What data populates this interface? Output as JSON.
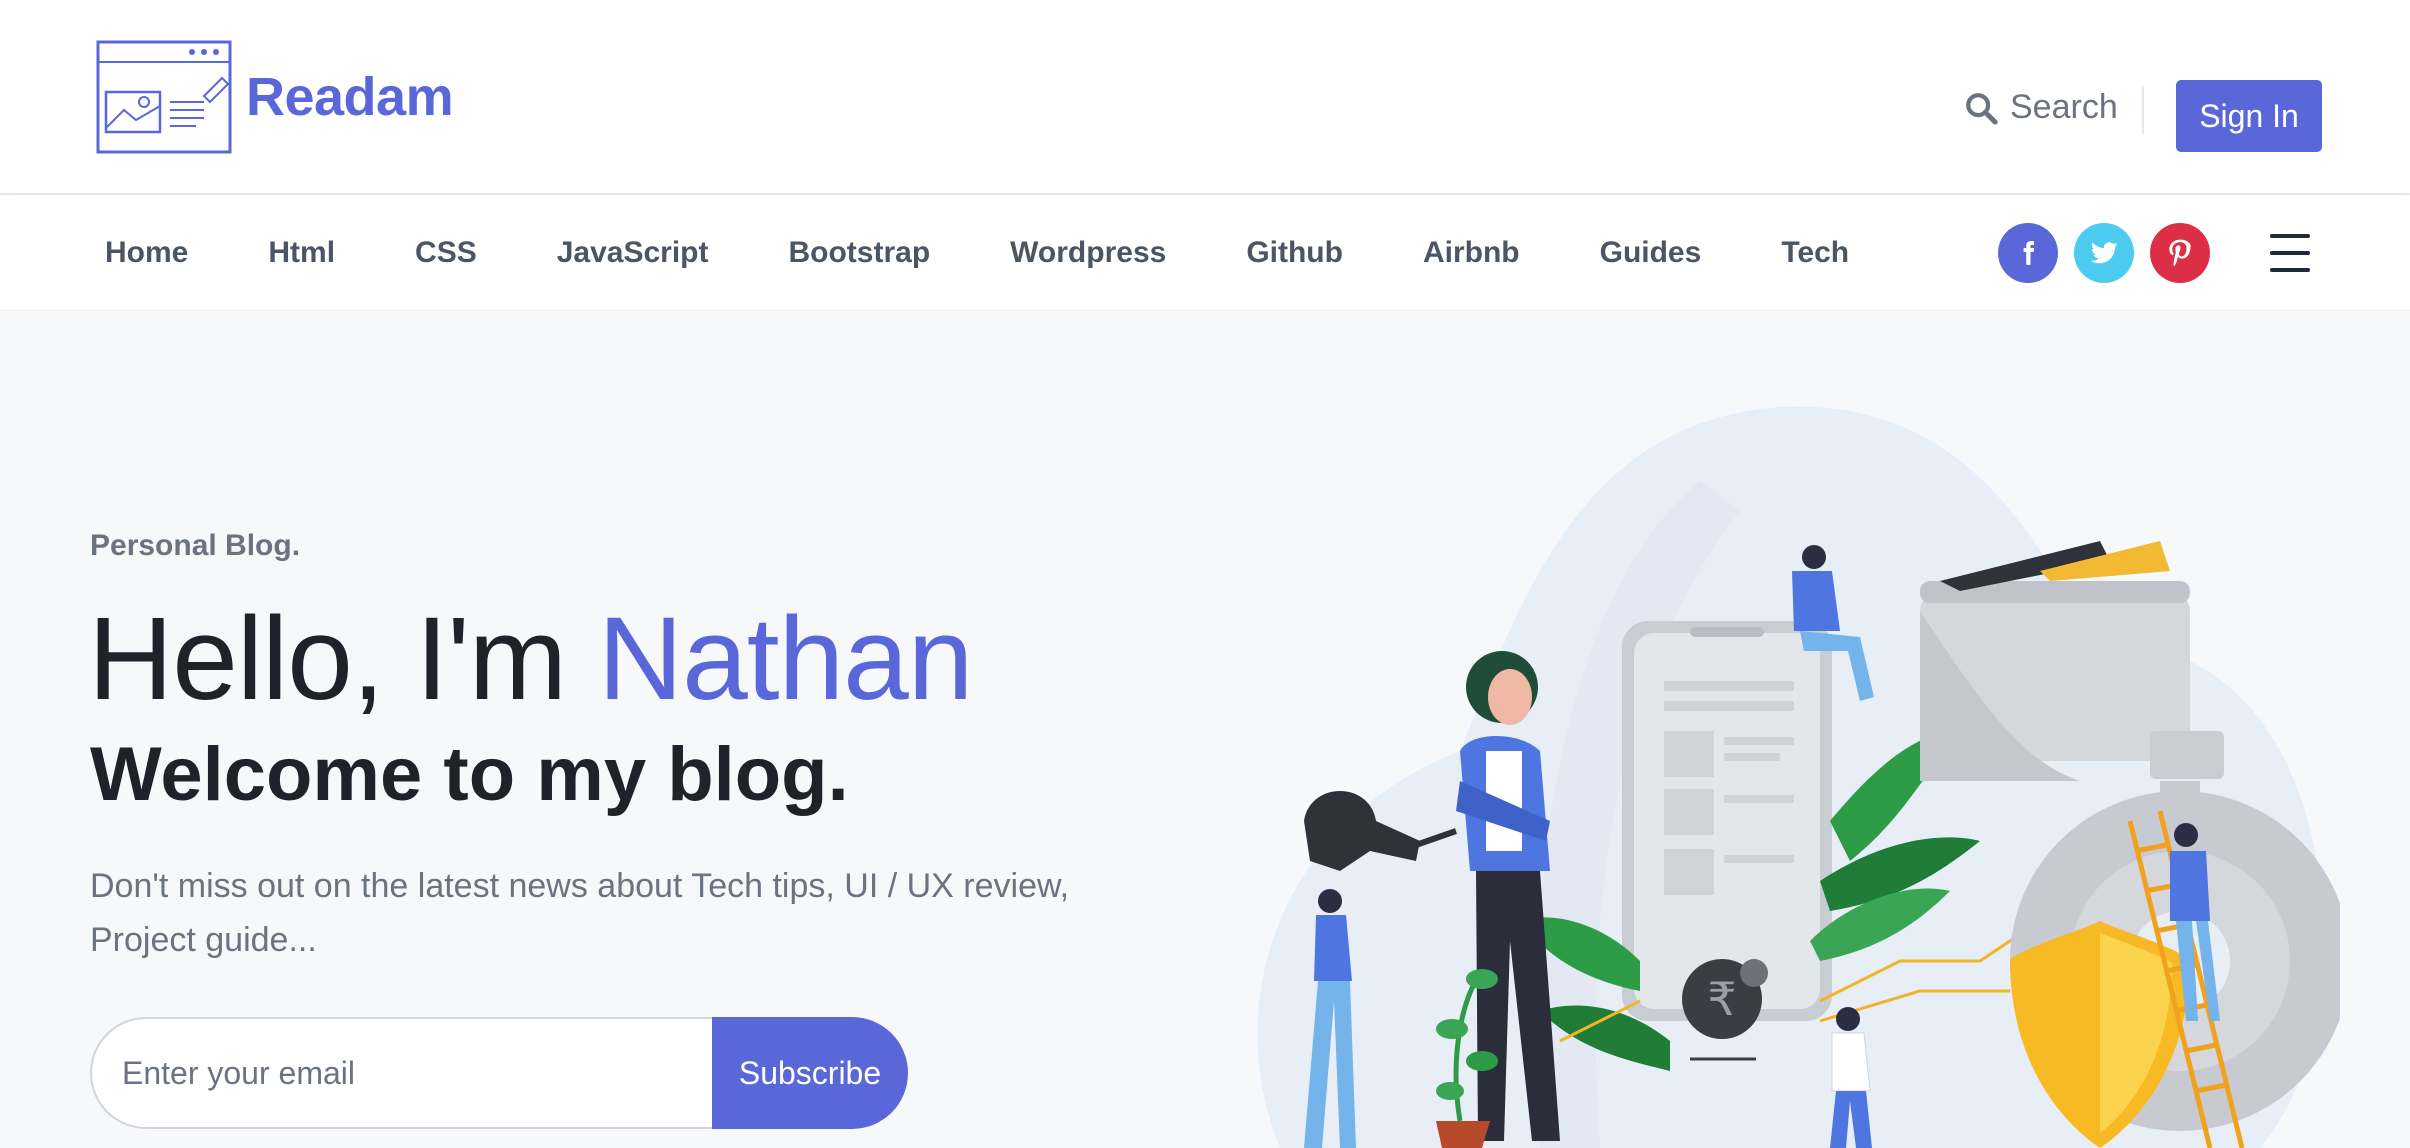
{
  "brand": {
    "name": "Readam",
    "logo_icon": "browser-window-icon",
    "color": "#5a67d8"
  },
  "header": {
    "search_label": "Search",
    "search_icon": "search-icon",
    "signin_label": "Sign In"
  },
  "nav": {
    "links": [
      "Home",
      "Html",
      "CSS",
      "JavaScript",
      "Bootstrap",
      "Wordpress",
      "Github",
      "Airbnb",
      "Guides",
      "Tech"
    ],
    "social": [
      {
        "name": "facebook-icon",
        "color": "#5a67d8"
      },
      {
        "name": "twitter-icon",
        "color": "#4ecbf0"
      },
      {
        "name": "pinterest-icon",
        "color": "#dc2f45"
      }
    ],
    "menu_icon": "hamburger-menu-icon"
  },
  "hero": {
    "eyebrow": "Personal Blog.",
    "headline_prefix": "Hello, I'm ",
    "headline_name": "Nathan",
    "subhead": "Welcome to my blog.",
    "description": "Don't miss out on the latest news about Tech tips, UI / UX review, Project guide...",
    "email_placeholder": "Enter your email",
    "subscribe_label": "Subscribe"
  }
}
